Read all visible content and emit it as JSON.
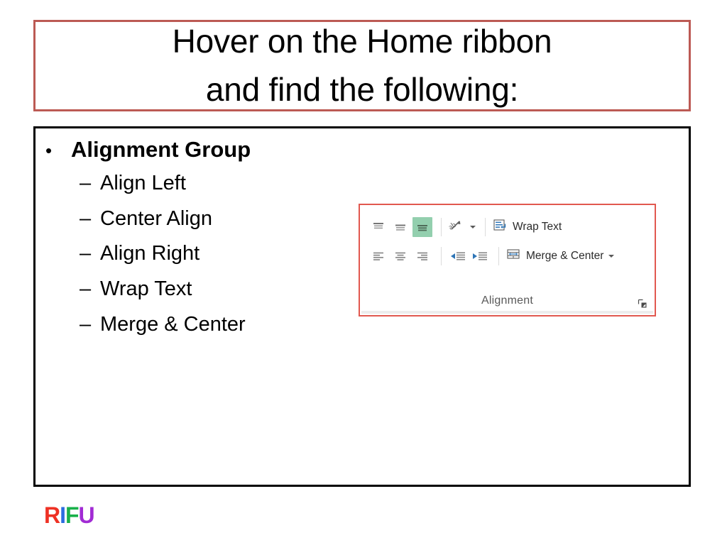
{
  "slide": {
    "title": {
      "lines": [
        "Hover on the Home ribbon",
        "and find the following:"
      ],
      "border_color": "#BC5A54"
    },
    "content": {
      "border_color": "#000000",
      "bullets": [
        {
          "level": 1,
          "marker": "•",
          "text": "Alignment Group"
        },
        {
          "level": 2,
          "marker": "–",
          "text": "Align Left"
        },
        {
          "level": 2,
          "marker": "–",
          "text": "Center Align"
        },
        {
          "level": 2,
          "marker": "–",
          "text": "Align Right"
        },
        {
          "level": 2,
          "marker": "–",
          "text": "Wrap Text"
        },
        {
          "level": 2,
          "marker": "–",
          "text": "Merge & Center"
        }
      ]
    },
    "ribbon_capture": {
      "border_color": "#E1584F",
      "group_label": "Alignment",
      "selected_highlight_color": "#93CFAE",
      "icon_accent_color": "#2E75B6",
      "row1": {
        "vertical_align": [
          {
            "icon": "align-top-icon",
            "label": "Top Align",
            "selected": false
          },
          {
            "icon": "align-middle-icon",
            "label": "Middle Align",
            "selected": false
          },
          {
            "icon": "align-bottom-icon",
            "label": "Bottom Align",
            "selected": true
          }
        ],
        "orientation": {
          "icon": "orientation-icon",
          "label": "Orientation",
          "has_dropdown": true
        },
        "wrap_text": {
          "icon": "wrap-text-icon",
          "label": "Wrap Text"
        }
      },
      "row2": {
        "horizontal_align": [
          {
            "icon": "align-left-icon",
            "label": "Align Left"
          },
          {
            "icon": "align-center-icon",
            "label": "Center"
          },
          {
            "icon": "align-right-icon",
            "label": "Align Right"
          }
        ],
        "indent": [
          {
            "icon": "decrease-indent-icon",
            "label": "Decrease Indent"
          },
          {
            "icon": "increase-indent-icon",
            "label": "Increase Indent"
          }
        ],
        "merge_center": {
          "icon": "merge-center-icon",
          "label": "Merge & Center",
          "has_dropdown": true
        }
      },
      "dialog_launcher": {
        "icon": "dialog-box-launcher-icon",
        "label": "Format Cells"
      }
    },
    "logo": {
      "letters": [
        {
          "char": "R",
          "color": "#EE3124"
        },
        {
          "char": "I",
          "color": "#2B6CE0"
        },
        {
          "char": "F",
          "color": "#19B04A"
        },
        {
          "char": "U",
          "color": "#A12BD4"
        }
      ]
    }
  }
}
